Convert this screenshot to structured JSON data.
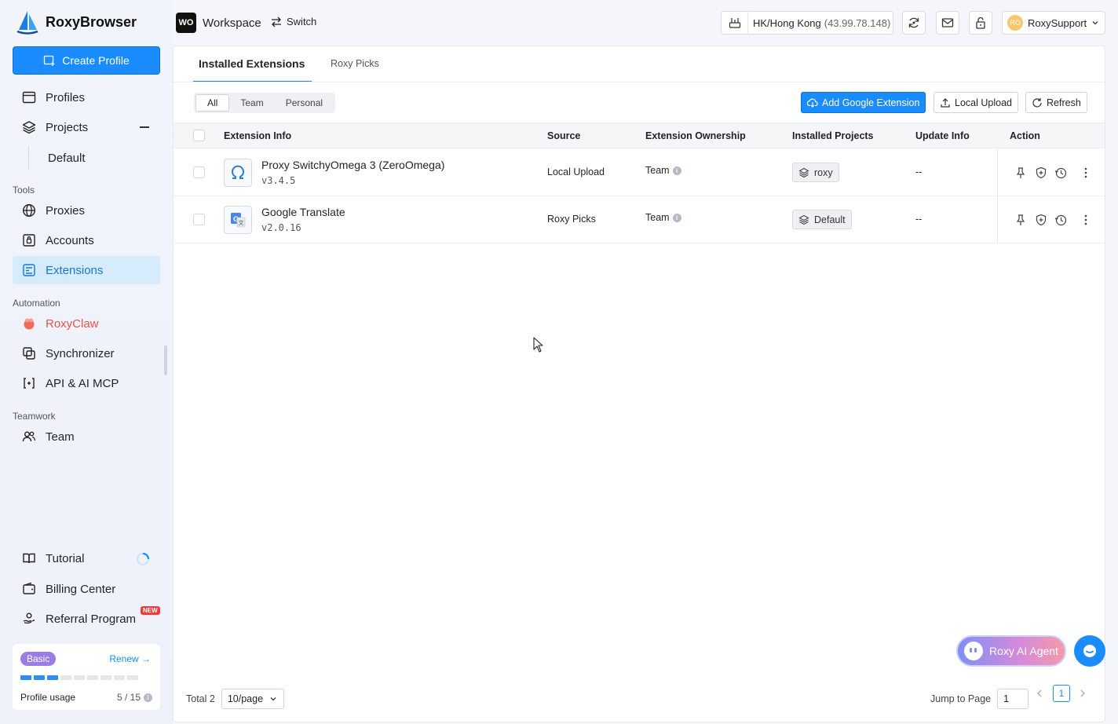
{
  "app": {
    "name": "RoxyBrowser"
  },
  "sidebar": {
    "create_label": "Create Profile",
    "profiles": "Profiles",
    "projects": "Projects",
    "projects_sub": "Default",
    "tools_label": "Tools",
    "proxies": "Proxies",
    "accounts": "Accounts",
    "extensions": "Extensions",
    "automation_label": "Automation",
    "roxyclaw": "RoxyClaw",
    "synchronizer": "Synchronizer",
    "api": "API & AI MCP",
    "teamwork_label": "Teamwork",
    "team": "Team",
    "tutorial": "Tutorial",
    "billing": "Billing Center",
    "referral": "Referral Program",
    "new_badge": "NEW",
    "plan": "Basic",
    "renew": "Renew →",
    "usage_label": "Profile usage",
    "usage_value": "5 / 15",
    "usage_fraction": 0.3333
  },
  "topbar": {
    "ws_badge": "WO",
    "workspace": "Workspace",
    "switch": "Switch",
    "proxy_location": "HK/Hong Kong",
    "proxy_ip": "(43.99.78.148)",
    "user_initials": "RO",
    "user": "RoxySupport"
  },
  "tabs": {
    "installed": "Installed Extensions",
    "picks": "Roxy Picks"
  },
  "filters": {
    "all": "All",
    "team": "Team",
    "personal": "Personal"
  },
  "actions": {
    "add": "Add Google Extension",
    "upload": "Local Upload",
    "refresh": "Refresh"
  },
  "table": {
    "headers": {
      "info": "Extension Info",
      "source": "Source",
      "ownership": "Extension Ownership",
      "projects": "Installed Projects",
      "update": "Update Info",
      "action": "Action"
    },
    "rows": [
      {
        "name": "Proxy SwitchyOmega 3 (ZeroOmega)",
        "version": "v3.4.5",
        "source": "Local Upload",
        "ownership": "Team",
        "project": "roxy",
        "update": "--"
      },
      {
        "name": "Google Translate",
        "version": "v2.0.16",
        "source": "Roxy Picks",
        "ownership": "Team",
        "project": "Default",
        "update": "--"
      }
    ]
  },
  "pagination": {
    "total": "Total 2",
    "page_size": "10/page",
    "jump_label": "Jump to Page",
    "jump_value": "1",
    "current": "1"
  },
  "ai_agent": "Roxy AI Agent",
  "colors": {
    "accent": "#1a8cff",
    "active_bg": "#d6ebfb",
    "roxyclaw": "#e8534a"
  }
}
